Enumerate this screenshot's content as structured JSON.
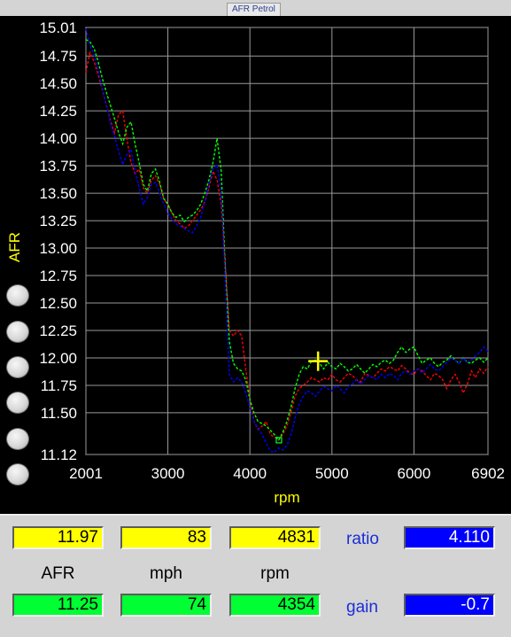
{
  "window": {
    "title": "AFR Petrol"
  },
  "colors": {
    "run1": "#ff0000",
    "run2": "#00ff00",
    "run3": "#0000ff",
    "cursor": "#ffff00",
    "readout_current": "#ffff00",
    "readout_reference": "#00ff33",
    "param": "#0000ff"
  },
  "side_buttons": [
    "round-button",
    "round-button",
    "round-button",
    "round-button",
    "round-button",
    "round-button"
  ],
  "chart_data": {
    "type": "line",
    "title": "",
    "xlabel": "rpm",
    "ylabel": "AFR",
    "xlim": [
      2001,
      6902
    ],
    "ylim": [
      11.12,
      15.01
    ],
    "x_ticks": [
      "2001",
      "3000",
      "4000",
      "5000",
      "6000",
      "6902"
    ],
    "y_ticks": [
      "15.01",
      "14.75",
      "14.50",
      "14.25",
      "14.00",
      "13.75",
      "13.50",
      "13.25",
      "13.00",
      "12.75",
      "12.50",
      "12.25",
      "12.00",
      "11.75",
      "11.50",
      "11.12"
    ],
    "grid": true,
    "cursor": {
      "rpm": 4831,
      "afr": 11.97
    },
    "marker": {
      "rpm": 4354,
      "afr": 11.25
    },
    "series": [
      {
        "color": "#ff0000",
        "x": [
          2001,
          2050,
          2100,
          2150,
          2200,
          2250,
          2300,
          2350,
          2400,
          2450,
          2500,
          2550,
          2600,
          2650,
          2700,
          2750,
          2800,
          2850,
          2900,
          2950,
          3000,
          3050,
          3100,
          3150,
          3200,
          3250,
          3300,
          3350,
          3400,
          3450,
          3500,
          3550,
          3600,
          3650,
          3700,
          3750,
          3800,
          3850,
          3900,
          3950,
          4000,
          4050,
          4100,
          4150,
          4200,
          4250,
          4300,
          4350,
          4400,
          4450,
          4500,
          4550,
          4600,
          4650,
          4700,
          4750,
          4800,
          4850,
          4900,
          4950,
          5000,
          5050,
          5100,
          5150,
          5200,
          5250,
          5300,
          5350,
          5400,
          5450,
          5500,
          5550,
          5600,
          5650,
          5700,
          5750,
          5800,
          5850,
          5900,
          5950,
          6000,
          6050,
          6100,
          6150,
          6200,
          6250,
          6300,
          6350,
          6400,
          6450,
          6500,
          6550,
          6600,
          6650,
          6700,
          6750,
          6800,
          6850,
          6902
        ],
        "y": [
          14.6,
          14.78,
          14.7,
          14.58,
          14.45,
          14.3,
          14.16,
          14.05,
          14.22,
          14.25,
          14.0,
          13.78,
          13.68,
          13.72,
          13.55,
          13.5,
          13.62,
          13.66,
          13.58,
          13.45,
          13.4,
          13.32,
          13.25,
          13.22,
          13.18,
          13.2,
          13.25,
          13.3,
          13.35,
          13.42,
          13.55,
          13.7,
          13.62,
          13.4,
          12.85,
          12.25,
          12.2,
          12.25,
          12.2,
          11.9,
          11.62,
          11.42,
          11.35,
          11.38,
          11.42,
          11.3,
          11.28,
          11.25,
          11.3,
          11.38,
          11.5,
          11.65,
          11.72,
          11.75,
          11.78,
          11.82,
          11.8,
          11.78,
          11.82,
          11.8,
          11.85,
          11.8,
          11.78,
          11.82,
          11.86,
          11.84,
          11.8,
          11.78,
          11.86,
          11.84,
          11.82,
          11.86,
          11.9,
          11.88,
          11.92,
          11.9,
          11.88,
          11.93,
          11.9,
          11.86,
          11.85,
          11.9,
          11.88,
          11.84,
          11.8,
          11.86,
          11.84,
          11.8,
          11.72,
          11.8,
          11.85,
          11.78,
          11.68,
          11.76,
          11.88,
          11.82,
          11.9,
          11.86,
          11.92
        ]
      },
      {
        "color": "#00ff00",
        "x": [
          2001,
          2050,
          2100,
          2150,
          2200,
          2250,
          2300,
          2350,
          2400,
          2450,
          2500,
          2550,
          2600,
          2650,
          2700,
          2750,
          2800,
          2850,
          2900,
          2950,
          3000,
          3050,
          3100,
          3150,
          3200,
          3250,
          3300,
          3350,
          3400,
          3450,
          3500,
          3550,
          3600,
          3650,
          3700,
          3750,
          3800,
          3850,
          3900,
          3950,
          4000,
          4050,
          4100,
          4150,
          4200,
          4250,
          4300,
          4350,
          4400,
          4450,
          4500,
          4550,
          4600,
          4650,
          4700,
          4750,
          4800,
          4850,
          4900,
          4950,
          5000,
          5050,
          5100,
          5150,
          5200,
          5250,
          5300,
          5350,
          5400,
          5450,
          5500,
          5550,
          5600,
          5650,
          5700,
          5750,
          5800,
          5850,
          5900,
          5950,
          6000,
          6050,
          6100,
          6150,
          6200,
          6250,
          6300,
          6350,
          6400,
          6450,
          6500,
          6550,
          6600,
          6650,
          6700,
          6750,
          6800,
          6850,
          6902
        ],
        "y": [
          14.9,
          14.88,
          14.82,
          14.7,
          14.55,
          14.42,
          14.3,
          14.18,
          14.05,
          13.95,
          14.1,
          14.15,
          13.95,
          13.78,
          13.58,
          13.52,
          13.68,
          13.72,
          13.6,
          13.45,
          13.4,
          13.32,
          13.28,
          13.3,
          13.24,
          13.28,
          13.3,
          13.34,
          13.4,
          13.5,
          13.62,
          13.78,
          14.0,
          13.7,
          12.8,
          12.15,
          11.95,
          11.9,
          11.88,
          11.8,
          11.62,
          11.5,
          11.42,
          11.4,
          11.38,
          11.34,
          11.3,
          11.25,
          11.32,
          11.42,
          11.55,
          11.72,
          11.85,
          11.92,
          11.9,
          11.97,
          11.98,
          11.95,
          11.9,
          11.96,
          11.92,
          11.9,
          11.95,
          11.92,
          11.88,
          11.9,
          11.94,
          11.9,
          11.86,
          11.9,
          11.94,
          11.92,
          11.96,
          11.98,
          11.95,
          11.98,
          12.05,
          12.1,
          12.05,
          12.08,
          12.1,
          12.02,
          11.95,
          11.98,
          12.0,
          11.95,
          11.92,
          11.96,
          11.98,
          12.02,
          11.98,
          11.95,
          12.0,
          11.96,
          11.95,
          11.98,
          12.0,
          11.96,
          12.0
        ]
      },
      {
        "color": "#0000ff",
        "x": [
          2001,
          2050,
          2100,
          2150,
          2200,
          2250,
          2300,
          2350,
          2400,
          2450,
          2500,
          2550,
          2600,
          2650,
          2700,
          2750,
          2800,
          2850,
          2900,
          2950,
          3000,
          3050,
          3100,
          3150,
          3200,
          3250,
          3300,
          3350,
          3400,
          3450,
          3500,
          3550,
          3600,
          3650,
          3700,
          3750,
          3800,
          3850,
          3900,
          3950,
          4000,
          4050,
          4100,
          4150,
          4200,
          4250,
          4300,
          4350,
          4400,
          4450,
          4500,
          4550,
          4600,
          4650,
          4700,
          4750,
          4800,
          4850,
          4900,
          4950,
          5000,
          5050,
          5100,
          5150,
          5200,
          5250,
          5300,
          5350,
          5400,
          5450,
          5500,
          5550,
          5600,
          5650,
          5700,
          5750,
          5800,
          5850,
          5900,
          5950,
          6000,
          6050,
          6100,
          6150,
          6200,
          6250,
          6300,
          6350,
          6400,
          6450,
          6500,
          6550,
          6600,
          6650,
          6700,
          6750,
          6800,
          6850,
          6902
        ],
        "y": [
          15.0,
          14.85,
          14.76,
          14.62,
          14.46,
          14.3,
          14.14,
          14.02,
          13.88,
          13.76,
          13.85,
          13.9,
          13.7,
          13.55,
          13.4,
          13.46,
          13.58,
          13.6,
          13.5,
          13.4,
          13.32,
          13.26,
          13.22,
          13.2,
          13.18,
          13.16,
          13.14,
          13.2,
          13.28,
          13.42,
          13.58,
          13.72,
          13.76,
          13.5,
          12.7,
          11.85,
          11.78,
          11.82,
          11.78,
          11.68,
          11.55,
          11.42,
          11.36,
          11.3,
          11.22,
          11.15,
          11.14,
          11.18,
          11.16,
          11.2,
          11.3,
          11.45,
          11.58,
          11.65,
          11.7,
          11.68,
          11.65,
          11.7,
          11.74,
          11.72,
          11.7,
          11.75,
          11.72,
          11.68,
          11.74,
          11.76,
          11.8,
          11.76,
          11.8,
          11.84,
          11.82,
          11.8,
          11.85,
          11.82,
          11.86,
          11.84,
          11.8,
          11.86,
          11.88,
          11.85,
          11.88,
          11.9,
          11.86,
          11.9,
          11.94,
          11.9,
          11.88,
          11.92,
          11.96,
          12.0,
          11.98,
          11.95,
          12.0,
          11.96,
          11.98,
          12.02,
          12.05,
          12.1,
          12.06
        ]
      }
    ]
  },
  "readouts": {
    "current": {
      "afr": "11.97",
      "mph": "83",
      "rpm": "4831"
    },
    "labels": {
      "afr": "AFR",
      "mph": "mph",
      "rpm": "rpm"
    },
    "reference": {
      "afr": "11.25",
      "mph": "74",
      "rpm": "4354"
    }
  },
  "params": {
    "ratio_label": "ratio",
    "ratio_value": "4.110",
    "gain_label": "gain",
    "gain_value": "-0.7"
  }
}
